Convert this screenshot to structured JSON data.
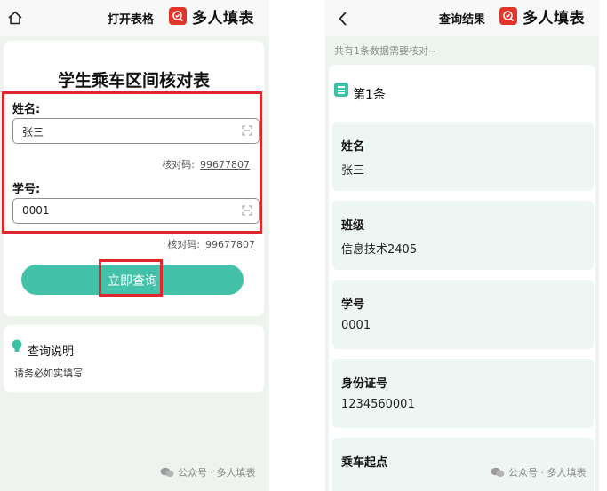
{
  "left": {
    "topbar_title": "打开表格",
    "brand": "多人填表",
    "form_title": "学生乘车区间核对表",
    "fields": [
      {
        "label": "姓名:",
        "value": "张三",
        "verify_label": "核对码:",
        "verify_code": "99677807"
      },
      {
        "label": "学号:",
        "value": "0001",
        "verify_label": "核对码:",
        "verify_code": "99677807"
      }
    ],
    "query_button": "立即查询",
    "help_title": "查询说明",
    "help_text": "请务必如实填写",
    "watermark": "公众号 · 多人填表"
  },
  "right": {
    "topbar_title": "查询结果",
    "brand": "多人填表",
    "summary": "共有1条数据需要核对~",
    "entry_title": "第1条",
    "items": [
      {
        "key": "姓名",
        "value": "张三"
      },
      {
        "key": "班级",
        "value": "信息技术2405"
      },
      {
        "key": "学号",
        "value": "0001"
      },
      {
        "key": "身份证号",
        "value": "1234560001"
      },
      {
        "key": "乘车起点",
        "value": ""
      }
    ],
    "watermark": "公众号 · 多人填表"
  },
  "colors": {
    "accent": "#44c2a9",
    "highlight": "#e0262a",
    "brand": "#e0352b"
  },
  "icons": [
    "home-icon",
    "back-icon",
    "brand-logo-icon",
    "scan-icon",
    "bulb-icon",
    "list-icon",
    "wechat-icon"
  ]
}
